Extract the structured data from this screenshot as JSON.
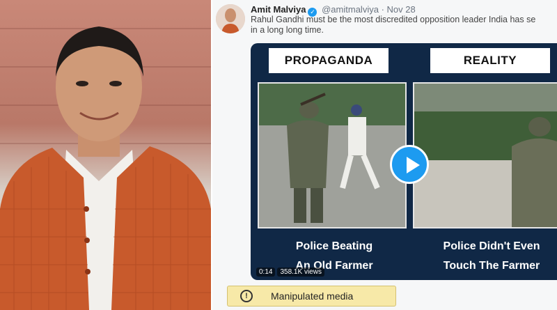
{
  "tweet": {
    "author_name": "Amit Malviya",
    "handle": "@amitmalviya",
    "separator": "·",
    "date": "Nov 28",
    "text_line1": "Rahul Gandhi must be the most discredited opposition leader India has se",
    "text_line2": "in a long long time."
  },
  "media": {
    "left_label": "PROPAGANDA",
    "right_label": "REALITY",
    "left_caption_line1": "Police Beating",
    "left_caption_line2": "An Old Farmer",
    "right_caption_line1": "Police Didn't Even",
    "right_caption_line2": "Touch The Farmer",
    "duration": "0:14",
    "views": "358.1K views"
  },
  "banner": {
    "icon_glyph": "!",
    "label": "Manipulated media"
  },
  "icons": {
    "verified": "verified-badge-icon",
    "play": "play-icon",
    "warning": "warning-circle-icon"
  },
  "colors": {
    "media_bg": "#102846",
    "verified_blue": "#1d9bf0",
    "banner_bg": "#f7e9a8"
  }
}
